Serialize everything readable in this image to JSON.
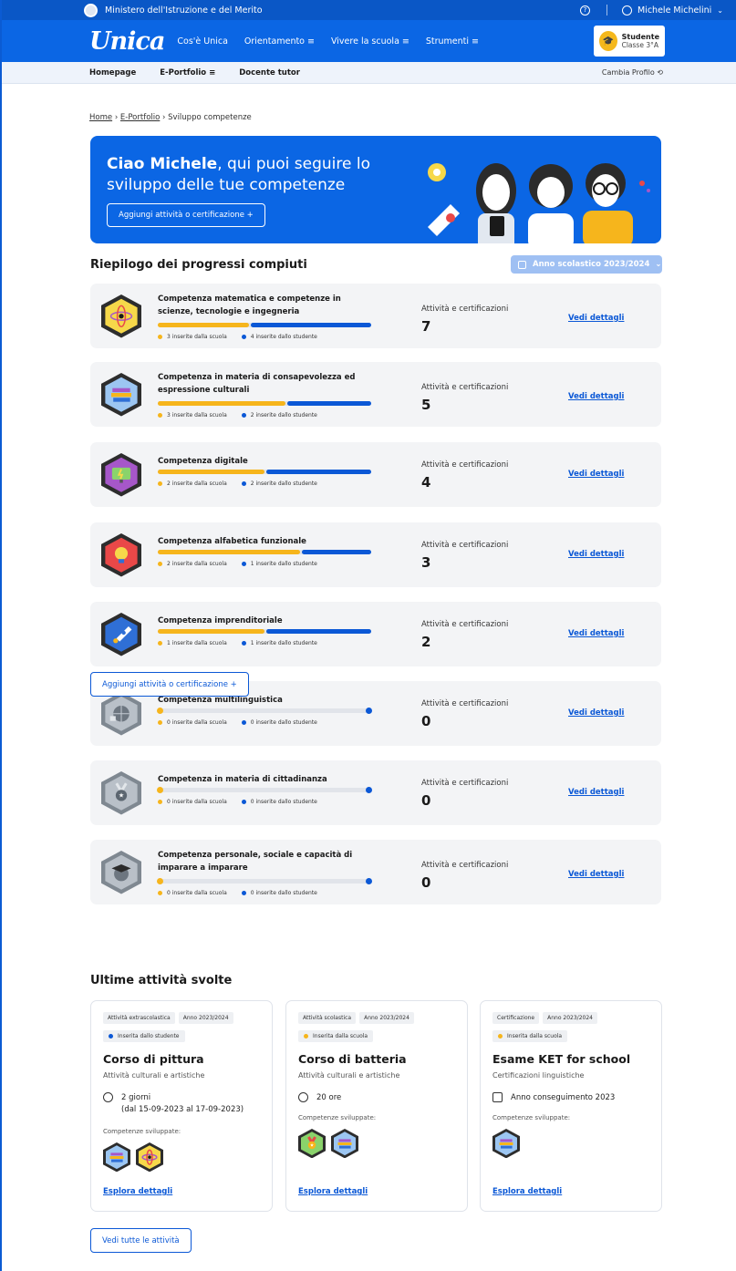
{
  "ministry": {
    "title": "Ministero dell'Istruzione e del Merito",
    "help_glyph": "?",
    "user_name": "Michele Michelini"
  },
  "nav": {
    "logo": "Unica",
    "items": [
      "Cos'è Unica",
      "Orientamento ≡",
      "Vivere la scuola ≡",
      "Strumenti ≡"
    ],
    "profile_role": "Studente",
    "profile_class": "Classe 3°A"
  },
  "subnav": {
    "items": [
      "Homepage",
      "E-Portfolio ≡",
      "Docente tutor"
    ],
    "switch_profile": "Cambia Profilo"
  },
  "breadcrumb": {
    "home": "Home",
    "portfolio": "E-Portfolio",
    "current": "Sviluppo competenze",
    "sep": "›"
  },
  "hero": {
    "greeting_bold": "Ciao Michele",
    "greeting_rest": ", qui puoi seguire lo sviluppo delle tue competenze",
    "button": "Aggiungi attività o certificazione +"
  },
  "summary": {
    "title": "Riepilogo dei progressi compiuti",
    "year": "Anno scolastico 2023/2024",
    "activities_label": "Attività e certificazioni",
    "details_label": "Vedi dettagli",
    "competences": [
      {
        "name": "Competenza matematica e competenze in scienze, tecnologie e ingegneria",
        "school": 3,
        "student": 4,
        "total": "7",
        "school_text": "3 inserite dalla scuola",
        "student_text": "4 inserite dallo studente",
        "icon": "atom-icon",
        "color": "#f6d84a"
      },
      {
        "name": "Competenza in materia di consapevolezza ed espressione culturali",
        "school": 3,
        "student": 2,
        "total": "5",
        "school_text": "3 inserite dalla scuola",
        "student_text": "2 inserite dallo studente",
        "icon": "books-icon",
        "color": "#9cc6f2"
      },
      {
        "name": "Competenza digitale",
        "school": 2,
        "student": 2,
        "total": "4",
        "school_text": "2 inserite dalla scuola",
        "student_text": "2 inserite dallo studente",
        "icon": "computer-icon",
        "color": "#a657c9"
      },
      {
        "name": "Competenza alfabetica funzionale",
        "school": 2,
        "student": 1,
        "total": "3",
        "school_text": "2 inserite dalla scuola",
        "student_text": "1 inserite dallo studente",
        "icon": "lightbulb-icon",
        "color": "#e94848"
      },
      {
        "name": "Competenza imprenditoriale",
        "school": 1,
        "student": 1,
        "total": "2",
        "school_text": "1 inserite dalla scuola",
        "student_text": "1 inserite dallo studente",
        "icon": "rocket-icon",
        "color": "#2f6fd6"
      },
      {
        "name": "Competenza multilinguistica",
        "school": 0,
        "student": 0,
        "total": "0",
        "school_text": "0 inserite dalla scuola",
        "student_text": "0 inserite dallo studente",
        "icon": "globe-icon",
        "color": "#9aa3ad"
      },
      {
        "name": "Competenza in materia di cittadinanza",
        "school": 0,
        "student": 0,
        "total": "0",
        "school_text": "0 inserite dalla scuola",
        "student_text": "0 inserite dallo studente",
        "icon": "medal-icon",
        "color": "#9aa3ad"
      },
      {
        "name": "Competenza personale, sociale e capacità di imparare a imparare",
        "school": 0,
        "student": 0,
        "total": "0",
        "school_text": "0 inserite dalla scuola",
        "student_text": "0 inserite dallo studente",
        "icon": "graduation-icon",
        "color": "#9aa3ad"
      }
    ],
    "add_button": "Aggiungi attività o certificazione +"
  },
  "recent": {
    "title": "Ultime attività svolte",
    "competences_label": "Competenze sviluppate:",
    "explore_label": "Esplora dettagli",
    "all_button": "Vedi tutte le attività",
    "cards": [
      {
        "type": "Attività extrascolastica",
        "year": "Anno 2023/2024",
        "source": "Inserita dallo studente",
        "source_color": "#0b58d6",
        "title": "Corso di pittura",
        "category": "Attività culturali e artistiche",
        "meta_line1": "2 giorni",
        "meta_line2": "(dal 15-09-2023 al 17-09-2023)",
        "meta_icon": "clock-icon",
        "icons": [
          "books-icon",
          "atom-icon"
        ]
      },
      {
        "type": "Attività scolastica",
        "year": "Anno 2023/2024",
        "source": "Inserita dalla scuola",
        "source_color": "#f6b51c",
        "title": "Corso di batteria",
        "category": "Attività culturali e artistiche",
        "meta_line1": "20 ore",
        "meta_line2": "",
        "meta_icon": "clock-icon",
        "icons": [
          "medal-icon",
          "books-icon"
        ]
      },
      {
        "type": "Certificazione",
        "year": "Anno 2023/2024",
        "source": "Inserita dalla scuola",
        "source_color": "#f6b51c",
        "title": "Esame KET for school",
        "category": "Certificazioni linguistiche",
        "meta_line1": "Anno conseguimento 2023",
        "meta_line2": "",
        "meta_icon": "calendar-icon",
        "icons": [
          "books-icon"
        ]
      }
    ]
  }
}
